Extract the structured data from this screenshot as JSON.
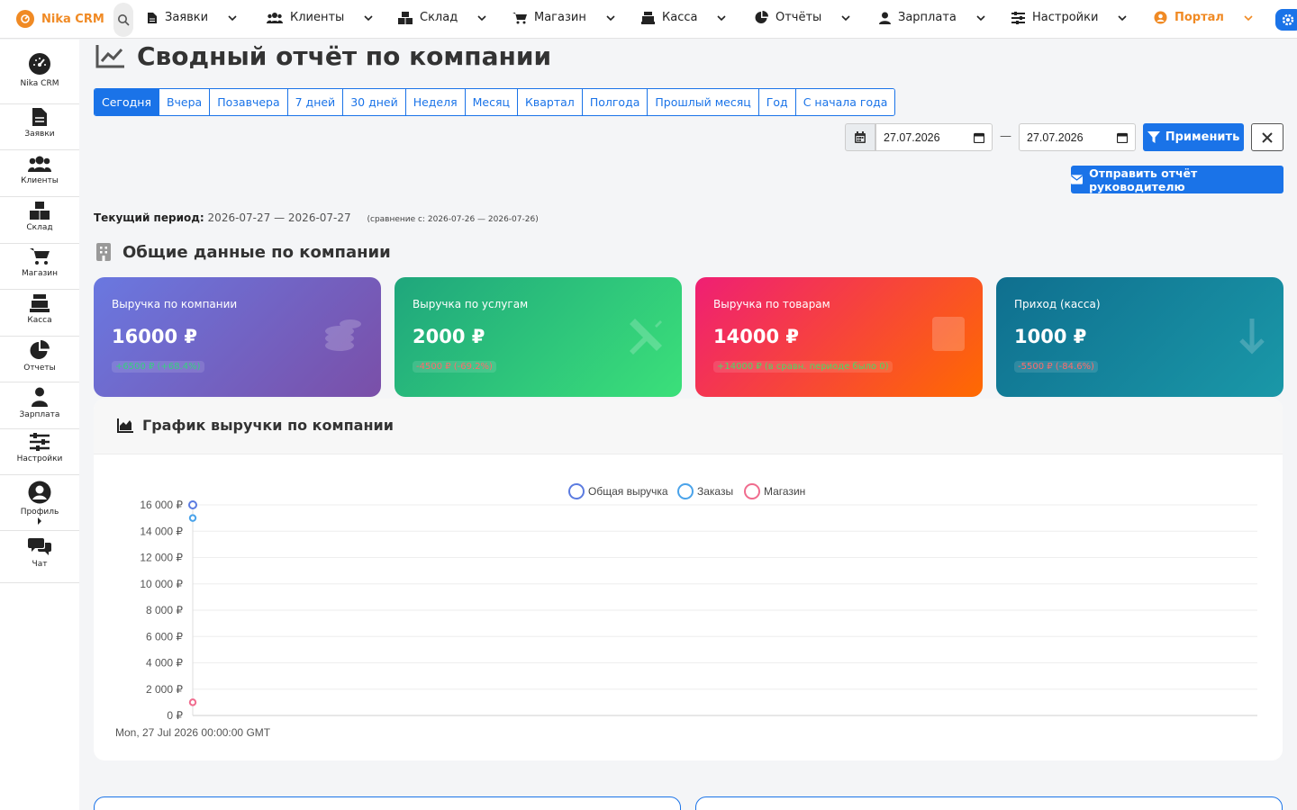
{
  "topnav": {
    "brand": "Nika CRM",
    "items": [
      {
        "label": "Заявки",
        "icon": "file-icon"
      },
      {
        "label": "Клиенты",
        "icon": "users-icon"
      },
      {
        "label": "Склад",
        "icon": "boxes-icon"
      },
      {
        "label": "Магазин",
        "icon": "cart-icon"
      },
      {
        "label": "Касса",
        "icon": "cash-register-icon"
      },
      {
        "label": "Отчёты",
        "icon": "pie-chart-icon"
      },
      {
        "label": "Зарплата",
        "icon": "user-tie-icon"
      },
      {
        "label": "Настройки",
        "icon": "sliders-icon"
      },
      {
        "label": "Портал",
        "icon": "user-circle-icon"
      }
    ]
  },
  "sidebar": {
    "items": [
      {
        "label": "Nika CRM"
      },
      {
        "label": "Заявки"
      },
      {
        "label": "Клиенты"
      },
      {
        "label": "Склад"
      },
      {
        "label": "Магазин"
      },
      {
        "label": "Касса"
      },
      {
        "label": "Отчеты"
      },
      {
        "label": "Зарплата"
      },
      {
        "label": "Настройки"
      },
      {
        "label": "Профиль"
      },
      {
        "label": "Чат"
      }
    ]
  },
  "page": {
    "title": "Сводный отчёт по компании"
  },
  "periods": [
    "Сегодня",
    "Вчера",
    "Позавчера",
    "7 дней",
    "30 дней",
    "Неделя",
    "Месяц",
    "Квартал",
    "Полгода",
    "Прошлый месяц",
    "Год",
    "С начала года"
  ],
  "filters": {
    "date_from": "27.07.2026",
    "date_to": "27.07.2026",
    "dash": "—",
    "apply_label": "Применить",
    "send_label": "Отправить отчёт руководителю"
  },
  "period_info": {
    "label": "Текущий период:",
    "value": "2026-07-27 — 2026-07-27",
    "compare": "(сравнение с: 2026-07-26 — 2026-07-26)"
  },
  "section": {
    "title": "Общие данные по компании"
  },
  "cards": [
    {
      "label": "Выручка по компании",
      "value": "16000 ₽",
      "change": "+6500 ₽ (+68.4%)",
      "change_color": "#35d07f",
      "gradient": [
        "#6a78e0",
        "#7a4fa8"
      ]
    },
    {
      "label": "Выручка по услугам",
      "value": "2000 ₽",
      "change": "-4500 ₽ (-69.2%)",
      "change_color": "#ff6b6b",
      "gradient": [
        "#1fa67c",
        "#3be07a"
      ]
    },
    {
      "label": "Выручка по товарам",
      "value": "14000 ₽",
      "change": "+14000 ₽ (в сравн. периоде было 0)",
      "change_color": "#4cd964",
      "gradient": [
        "#ef1f74",
        "#ff6a00"
      ]
    },
    {
      "label": "Приход (касса)",
      "value": "1000 ₽",
      "change": "-5500 ₽ (-84.6%)",
      "change_color": "#ff6b6b",
      "gradient": [
        "#0f6f8f",
        "#1a98a8"
      ]
    }
  ],
  "chart_section": {
    "title": "График выручки по компании"
  },
  "chart_data": {
    "type": "scatter",
    "title": "",
    "xlabel": "",
    "ylabel": "",
    "x": [
      "Mon, 27 Jul 2026 00:00:00 GMT"
    ],
    "series": [
      {
        "name": "Общая выручка",
        "values": [
          16000
        ],
        "color": "#5b7be0"
      },
      {
        "name": "Заказы",
        "values": [
          15000
        ],
        "color": "#4aa3ea"
      },
      {
        "name": "Магазин",
        "values": [
          1000
        ],
        "color": "#f06c8e"
      }
    ],
    "ylim": [
      0,
      16000
    ],
    "yticks": [
      "0 ₽",
      "2 000 ₽",
      "4 000 ₽",
      "6 000 ₽",
      "8 000 ₽",
      "10 000 ₽",
      "12 000 ₽",
      "14 000 ₽",
      "16 000 ₽"
    ],
    "grid": true,
    "legend": "top-center"
  }
}
